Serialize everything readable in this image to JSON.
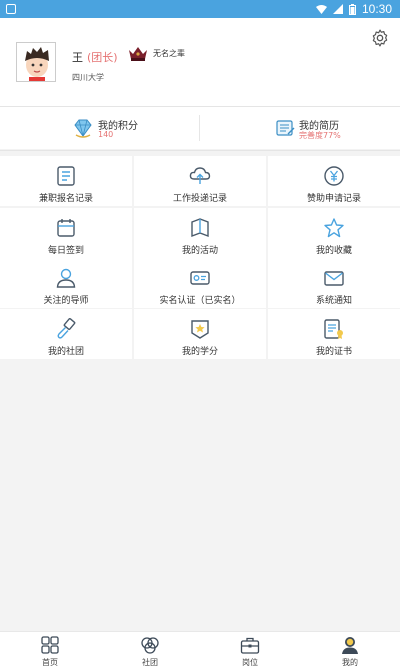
{
  "status_bar": {
    "time": "10:30"
  },
  "profile": {
    "name": "王",
    "role": "(团长)",
    "school": "四川大学",
    "badge_label": "无名之辈"
  },
  "stats": [
    {
      "title": "我的积分",
      "value": "140"
    },
    {
      "title": "我的简历",
      "value": "完善度77%"
    }
  ],
  "menu": [
    {
      "label": "兼职报名记录",
      "icon": "document-list-icon"
    },
    {
      "label": "工作投递记录",
      "icon": "cloud-upload-icon"
    },
    {
      "label": "赞助申请记录",
      "icon": "yen-coin-icon"
    },
    {
      "label": "每日签到",
      "icon": "calendar-icon"
    },
    {
      "label": "我的活动",
      "icon": "flag-icon"
    },
    {
      "label": "我的收藏",
      "icon": "star-icon"
    },
    {
      "label": "关注的导师",
      "icon": "person-icon"
    },
    {
      "label": "实名认证（已实名）",
      "icon": "id-card-icon"
    },
    {
      "label": "系统通知",
      "icon": "envelope-icon"
    },
    {
      "label": "我的社团",
      "icon": "brush-icon"
    },
    {
      "label": "我的学分",
      "icon": "star-badge-icon"
    },
    {
      "label": "我的证书",
      "icon": "certificate-icon"
    }
  ],
  "tabs": [
    {
      "label": "首页",
      "icon": "home-grid-icon"
    },
    {
      "label": "社团",
      "icon": "club-icon"
    },
    {
      "label": "岗位",
      "icon": "briefcase-icon"
    },
    {
      "label": "我的",
      "icon": "user-icon",
      "active": true
    }
  ],
  "colors": {
    "status_bar": "#4aa3df",
    "accent_red": "#e57373",
    "icon_blue": "#4aa3df",
    "icon_dark": "#4a5a6a"
  }
}
